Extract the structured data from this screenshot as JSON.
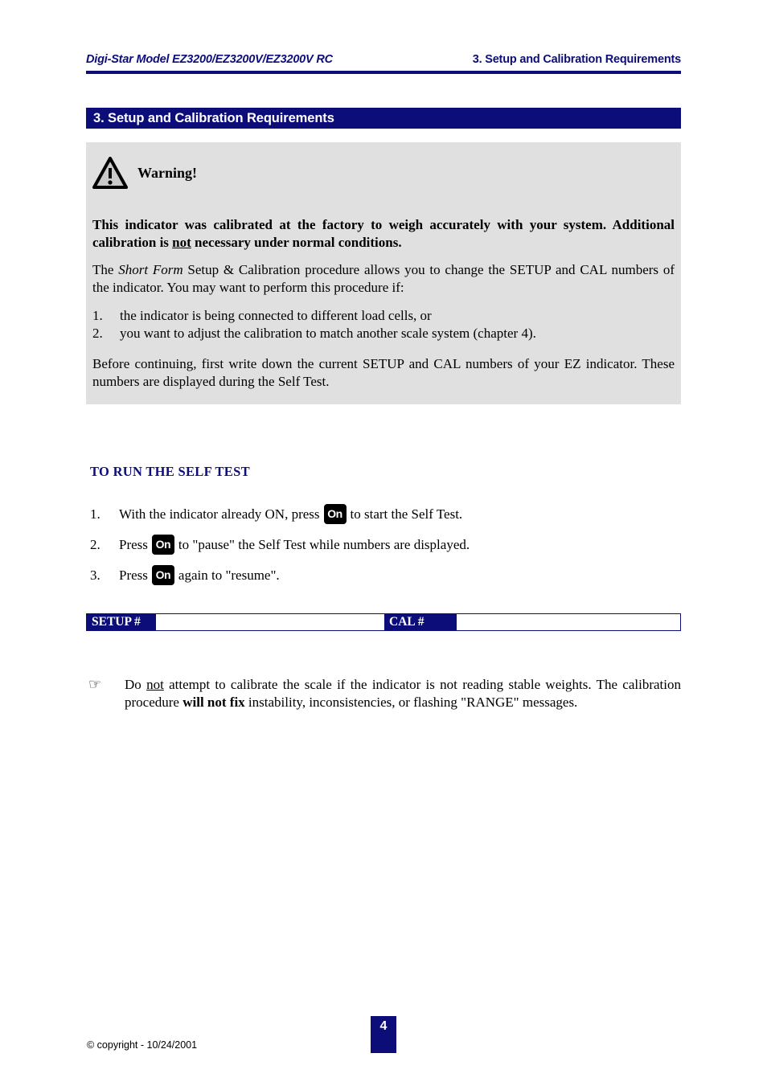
{
  "header": {
    "left": "Digi-Star Model EZ3200/EZ3200V/EZ3200V RC",
    "right": "3. Setup and Calibration Requirements"
  },
  "chapter": {
    "title": "3.  Setup and Calibration Requirements"
  },
  "warning": {
    "icon": "warning-triangle-icon",
    "label": "Warning!",
    "paragraph_bold": {
      "part1": "This indicator was calibrated at the factory to weigh accurately with your system. Additional calibration is ",
      "emphasis": "not",
      "part2": " necessary under normal conditions."
    },
    "paragraph_short_form": {
      "part1": "The ",
      "italic": "Short Form",
      "part2": " Setup & Calibration procedure allows you to change the SETUP and CAL numbers of the indicator.  You may want to perform this procedure if:"
    },
    "list": [
      {
        "num": "1.",
        "text": "the indicator is being connected to different load cells, or"
      },
      {
        "num": "2.",
        "text": "you want to adjust the calibration to match another scale system (chapter 4)."
      }
    ],
    "paragraph_before": "Before continuing, first write down the current SETUP and CAL numbers of your EZ indicator.  These numbers are displayed during the Self Test."
  },
  "selftest": {
    "heading": "TO RUN THE SELF TEST",
    "key_label": "On",
    "steps": [
      {
        "num": "1.",
        "before": "With the indicator already ON, press",
        "after": "to start the Self Test."
      },
      {
        "num": "2.",
        "before": "Press",
        "after": "to \"pause\" the Self Test while numbers are displayed."
      },
      {
        "num": "3.",
        "before": "Press",
        "after": "again to \"resume\"."
      }
    ]
  },
  "record_table": {
    "setup_label": "SETUP #",
    "setup_value": "",
    "cal_label": "CAL #",
    "cal_value": ""
  },
  "note": {
    "bullet": "☞",
    "part1": "Do ",
    "underline": "not",
    "part2": " attempt to calibrate the scale if the indicator is not reading stable weights. The calibration procedure ",
    "bold": "will not fix",
    "part3": " instability, inconsistencies, or flashing \"RANGE\" messages."
  },
  "footer": {
    "copyright": "© copyright - 10/24/2001",
    "page_number": "4"
  },
  "colors": {
    "navy": "#0d0d7a",
    "gray_box": "#e0e0e0",
    "key_black": "#000000"
  }
}
